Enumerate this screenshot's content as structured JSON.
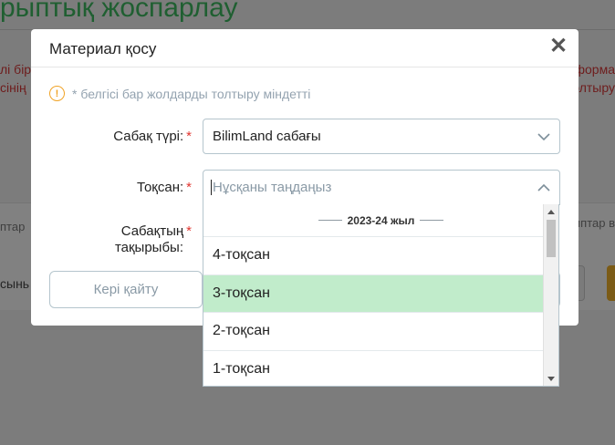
{
  "background": {
    "title": "рыптық жоспарлау",
    "alert_left_1": "лі бір",
    "alert_left_2": "сінің",
    "alert_right_1": "форма",
    "alert_right_2": "толтыру",
    "table_header_left": "птар",
    "table_header_right": "иптар в",
    "row_left": "сынь"
  },
  "modal": {
    "title": "Материал қосу",
    "close_symbol": "✕",
    "note": "* белгісі бар жолдарды толтыру міндетті",
    "required_mark": "*",
    "fields": {
      "lesson_type": {
        "label": "Сабақ түрі:",
        "value": "BilimLand сабағы"
      },
      "quarter": {
        "label": "Тоқсан:",
        "placeholder": "Нұсқаны таңдаңыз"
      },
      "topic": {
        "label_line1": "Сабақтың",
        "label_line2": "тақырыбы:"
      }
    },
    "back_button": "Кері қайту"
  },
  "dropdown": {
    "group_label": "2023-24 жыл",
    "options": [
      "4-тоқсан",
      "3-тоқсан",
      "2-тоқсан",
      "1-тоқсан"
    ],
    "highlighted": "3-тоқсан"
  },
  "colors": {
    "accent_green_title": "#1f5f31",
    "required_red": "#e1352f",
    "info_orange": "#f0a326",
    "highlight_green": "#c1eccb"
  }
}
